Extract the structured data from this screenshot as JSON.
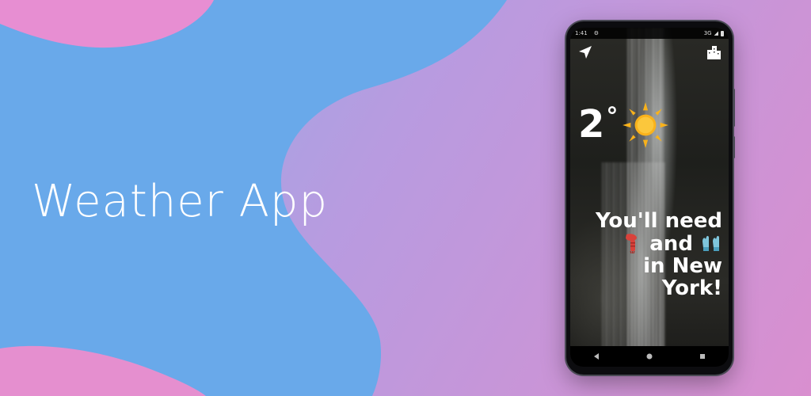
{
  "hero": {
    "title": "Weather App"
  },
  "phone": {
    "status_bar": {
      "time": "1:41",
      "network": "3G"
    },
    "weather": {
      "temperature": "2",
      "unit": "°",
      "condition_icon": "sun-icon"
    },
    "message": {
      "line1": "You'll need",
      "line2_word": "and",
      "line3": "in New",
      "line4": "York!",
      "item1_icon": "scarf-icon",
      "item2_icon": "gloves-icon"
    },
    "toolbar": {
      "location_icon": "navigation-arrow-icon",
      "city_icon": "city-buildings-icon"
    },
    "nav": [
      "back-icon",
      "home-icon",
      "recents-icon"
    ]
  },
  "colors": {
    "blob_blue": "#6aa8e8",
    "blob_pink": "#e58bd0",
    "sun": "#f9b21b",
    "scarf": "#d9423b",
    "gloves": "#7fc6dc"
  }
}
